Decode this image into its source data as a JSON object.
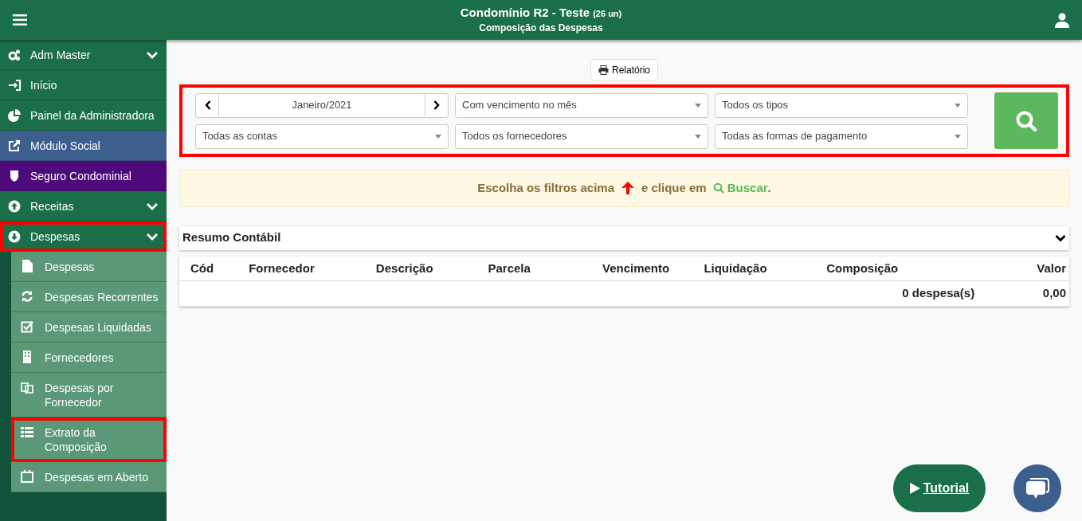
{
  "header": {
    "title": "Condomínio R2 - Teste",
    "units": "(26 un)",
    "subtitle": "Composição das Despesas"
  },
  "sidebar": {
    "items": [
      {
        "label": "Adm Master",
        "color": "#1a6e48",
        "expandable": true,
        "highlighted": false
      },
      {
        "label": "Início",
        "color": "#1a6e48",
        "expandable": false,
        "highlighted": false
      },
      {
        "label": "Painel da Administradora",
        "color": "#1a6e48",
        "expandable": false,
        "highlighted": false
      },
      {
        "label": "Módulo Social",
        "color": "#3d5f8d",
        "expandable": false,
        "highlighted": false
      },
      {
        "label": "Seguro Condominial",
        "color": "#4e0a7a",
        "expandable": false,
        "highlighted": false
      },
      {
        "label": "Receitas",
        "color": "#1a6e48",
        "expandable": true,
        "highlighted": false
      },
      {
        "label": "Despesas",
        "color": "#1a6e48",
        "expandable": true,
        "highlighted": true,
        "children": [
          {
            "label": "Despesas",
            "highlighted": false
          },
          {
            "label": "Despesas Recorrentes",
            "highlighted": false
          },
          {
            "label": "Despesas Liquidadas",
            "highlighted": false
          },
          {
            "label": "Fornecedores",
            "highlighted": false
          },
          {
            "label": "Despesas por Fornecedor",
            "highlighted": false
          },
          {
            "label": "Extrato da Composição",
            "highlighted": true
          },
          {
            "label": "Despesas em Aberto",
            "highlighted": false
          }
        ]
      }
    ]
  },
  "report_button": "Relatório",
  "filters": {
    "highlighted": true,
    "month": "Janeiro/2021",
    "selects": [
      "Com vencimento no mês",
      "Todos os tipos",
      "Todas as contas",
      "Todos os fornecedores",
      "Todas as formas de pagamento"
    ]
  },
  "alert": {
    "before": "Escolha os filtros acima",
    "middle": "e clique em",
    "link": "Buscar",
    "after": "."
  },
  "panel": {
    "title": "Resumo Contábil"
  },
  "table": {
    "columns": [
      "Cód",
      "Fornecedor",
      "Descrição",
      "Parcela",
      "Vencimento",
      "Liquidação",
      "Composição",
      "Valor"
    ],
    "count": "0 despesa(s)",
    "total": "0,00"
  },
  "tutorial_button": "Tutorial"
}
